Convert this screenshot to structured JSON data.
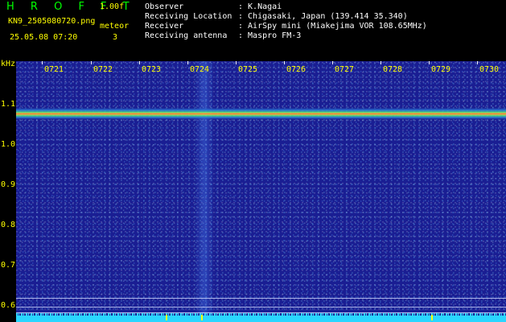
{
  "app": {
    "title": "H R O F F T",
    "version": "1.00f",
    "filename": "KN9_2505080720.png",
    "mode": "meteor",
    "datetime": "25.05.08 07:20",
    "mode_number": "3"
  },
  "meta": [
    {
      "key": "Observer",
      "value": ": K.Nagai"
    },
    {
      "key": "Receiving Location",
      "value": ": Chigasaki, Japan (139.414 35.340)"
    },
    {
      "key": "Receiver",
      "value": ": AirSpy mini (Miakejima VOR 108.65MHz)"
    },
    {
      "key": "Receiving antenna",
      "value": ": Maspro FM-3"
    }
  ],
  "axes": {
    "y_unit": "kHz",
    "y_ticks": [
      "1.1",
      "1.0",
      "0.9",
      "0.8",
      "0.7",
      "0.6"
    ],
    "x_ticks": [
      "0721",
      "0722",
      "0723",
      "0724",
      "0725",
      "0726",
      "0727",
      "0728",
      "0729",
      "0730"
    ]
  },
  "colors": {
    "background": "#000000",
    "spectrum_bg": "#1a1e93",
    "label": "#ffff00",
    "title": "#00ff00",
    "meta_text": "#ffffff",
    "signal": "#ff4a2a",
    "noise_floor": "#2ad6ff"
  }
}
